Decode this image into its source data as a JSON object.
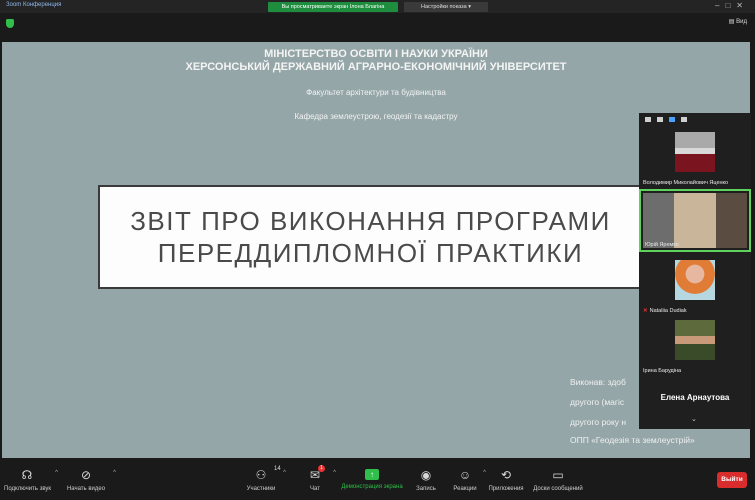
{
  "window": {
    "title": "Зоom Конференция",
    "status_pill": "Вы просматриваете экран Ілона Благіна",
    "view_options": "Настройки показа ▾",
    "view_button": "Вид"
  },
  "slide": {
    "ministry_line1": "МІНІСТЕРСТВО ОСВІТИ І НАУКИ УКРАЇНИ",
    "ministry_line2": "ХЕРСОНСЬКИЙ ДЕРЖАВНИЙ АГРАРНО-ЕКОНОМІЧНИЙ УНІВЕРСИТЕТ",
    "faculty": "Факультет архітектури та будівництва",
    "department": "Кафедра землеустрою, геодезії та кадастру",
    "title_line1": "ЗВІТ ПРО ВИКОНАННЯ ПРОГРАМИ",
    "title_line2": "ПЕРЕДДИПЛОМНОЇ ПРАКТИКИ",
    "author_lines": [
      "Виконав: здоб",
      "другого (магіс",
      "другого року н",
      "ОПП «Геодезія та землеустрій»"
    ]
  },
  "participants": {
    "tiles": [
      {
        "name": "Володимир Миколайович Яценко",
        "muted": false
      },
      {
        "name": "Юрій Яремко",
        "muted": false
      },
      {
        "name": "Nataliia Dudiak",
        "muted": true
      },
      {
        "name": "Ірина Барудіна",
        "muted": false
      }
    ],
    "active_speaker": "Елена Арнаутова"
  },
  "toolbar": {
    "audio": "Подключить звук",
    "video": "Начать видео",
    "participants": "Участники",
    "participants_count": "14",
    "chat": "Чат",
    "chat_badge": "1",
    "share": "Демонстрация экрана",
    "record": "Запись",
    "reactions": "Реакции",
    "apps": "Приложения",
    "whiteboard": "Доски сообщений",
    "leave": "Выйти"
  },
  "colors": {
    "slide_bg": "#95a6a8",
    "accent_green": "#2fbf4a",
    "leave_red": "#d92c2c"
  }
}
